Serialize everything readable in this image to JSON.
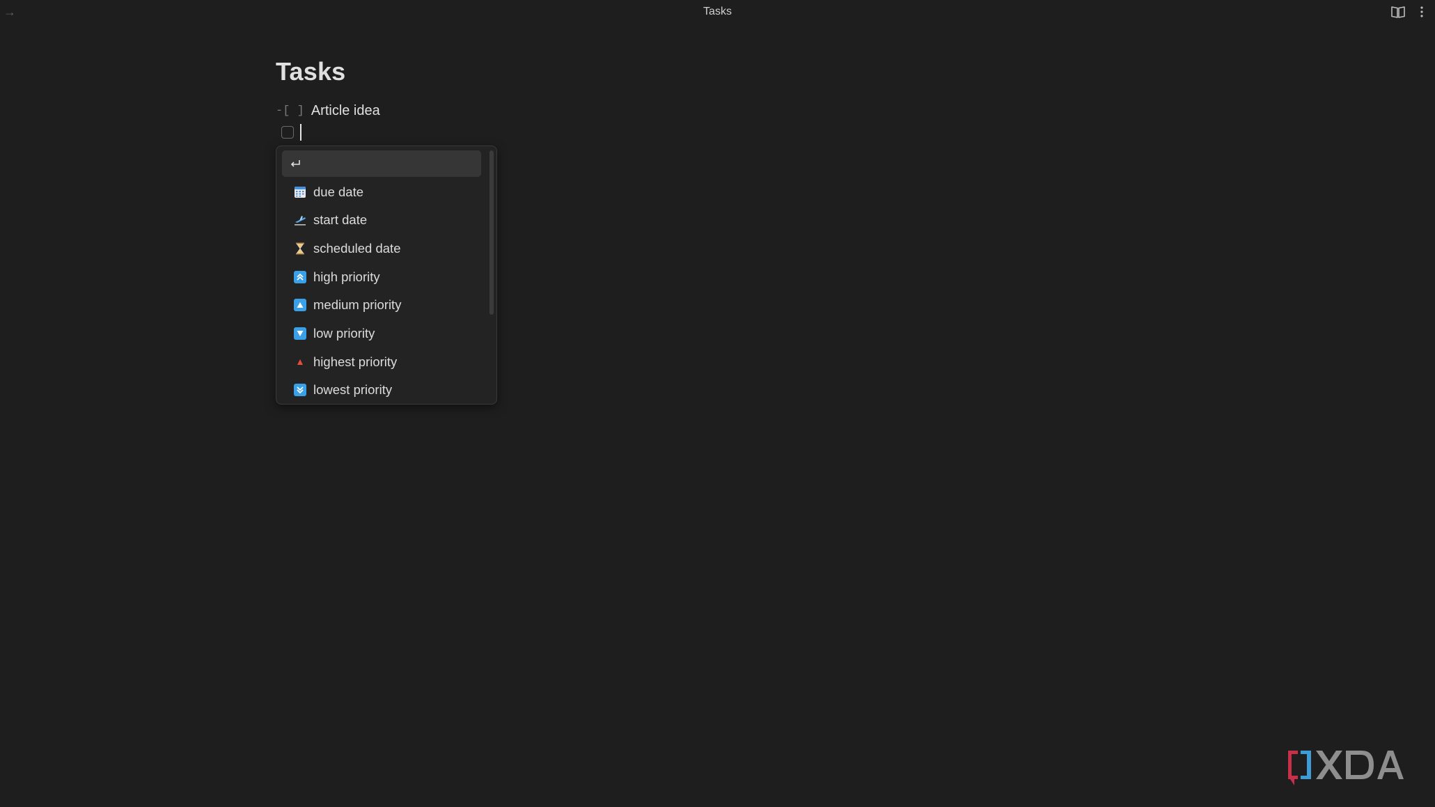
{
  "window": {
    "title": "Tasks"
  },
  "note": {
    "title": "Tasks",
    "task_prefix": "-[ ]",
    "task_text": "Article idea"
  },
  "suggestions": {
    "items": [
      {
        "icon": "return-icon",
        "label": ""
      },
      {
        "icon": "calendar-icon",
        "label": "due date"
      },
      {
        "icon": "airplane-departure-icon",
        "label": "start date"
      },
      {
        "icon": "hourglass-icon",
        "label": "scheduled date"
      },
      {
        "icon": "high-priority-icon",
        "label": "high priority"
      },
      {
        "icon": "medium-priority-icon",
        "label": "medium priority"
      },
      {
        "icon": "low-priority-icon",
        "label": "low priority"
      },
      {
        "icon": "highest-priority-icon",
        "label": "highest priority"
      },
      {
        "icon": "lowest-priority-icon",
        "label": "lowest priority"
      }
    ]
  },
  "watermark": {
    "text": "XDA"
  },
  "colors": {
    "background": "#1e1e1e",
    "accent_blue": "#3aa0e8",
    "highest_red": "#e74c3c",
    "xda_red": "#c8304a",
    "xda_blue": "#3d9bd6"
  }
}
